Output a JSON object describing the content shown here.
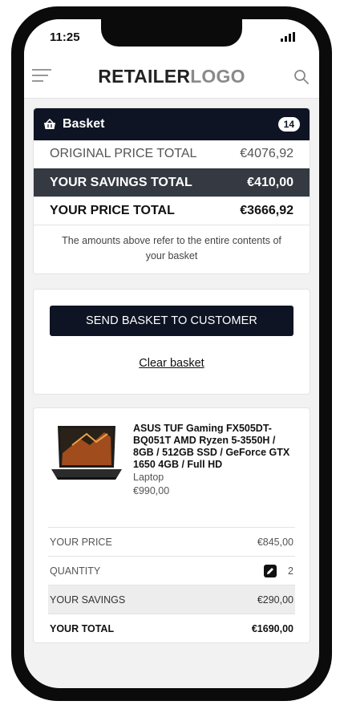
{
  "status_bar": {
    "time": "11:25"
  },
  "header": {
    "logo_part1": "RETAILER",
    "logo_part2": "LOGO"
  },
  "basket": {
    "title": "Basket",
    "count": "14",
    "original_label": "ORIGINAL PRICE TOTAL",
    "original_value": "€4076,92",
    "savings_label": "YOUR SAVINGS TOTAL",
    "savings_value": "€410,00",
    "price_label": "YOUR PRICE TOTAL",
    "price_value": "€3666,92",
    "note": "The amounts above refer to the entire contents of your basket"
  },
  "actions": {
    "send_label": "SEND BASKET TO CUSTOMER",
    "clear_label": "Clear basket"
  },
  "product": {
    "name": "ASUS TUF Gaming FX505DT-BQ051T AMD Ryzen 5-3550H / 8GB / 512GB SSD / GeForce GTX 1650 4GB / Full HD",
    "category": "Laptop",
    "list_price": "€990,00",
    "your_price_label": "YOUR PRICE",
    "your_price_value": "€845,00",
    "quantity_label": "QUANTITY",
    "quantity_value": "2",
    "savings_label": "YOUR SAVINGS",
    "savings_value": "€290,00",
    "total_label": "YOUR TOTAL",
    "total_value": "€1690,00"
  },
  "icons": {
    "menu": "hamburger-menu-icon",
    "search": "search-icon",
    "basket": "basket-icon",
    "edit": "pencil-icon",
    "signal": "cellular-signal-icon"
  }
}
